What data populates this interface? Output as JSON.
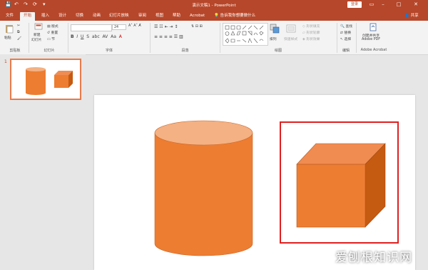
{
  "window": {
    "title": "演示文稿1 - PowerPoint",
    "login_label": "登录",
    "quick_access": [
      "💾",
      "↶",
      "↷",
      "⟳"
    ]
  },
  "tabs": [
    {
      "label": "文件"
    },
    {
      "label": "开始",
      "active": true
    },
    {
      "label": "插入"
    },
    {
      "label": "设计"
    },
    {
      "label": "切换"
    },
    {
      "label": "动画"
    },
    {
      "label": "幻灯片放映"
    },
    {
      "label": "审阅"
    },
    {
      "label": "视图"
    },
    {
      "label": "帮助"
    },
    {
      "label": "Acrobat"
    }
  ],
  "tell_me": "告诉我你想要做什么",
  "share_label": "共享",
  "ribbon": {
    "clipboard": {
      "paste": "粘贴",
      "group": "剪贴板"
    },
    "slides": {
      "new_slide_line1": "新建",
      "new_slide_line2": "幻灯片",
      "layout": "版式",
      "reset": "重置",
      "section": "节",
      "group": "幻灯片"
    },
    "font": {
      "size": "24",
      "group": "字体"
    },
    "paragraph": {
      "group": "段落"
    },
    "drawing": {
      "arrange": "排列",
      "quick_styles": "快速样式",
      "fill": "形状填充",
      "outline": "形状轮廓",
      "effects": "形状效果",
      "group": "绘图"
    },
    "editing": {
      "find": "查找",
      "replace": "替换",
      "select": "选择",
      "group": "编辑"
    },
    "acrobat": {
      "create_line1": "创建并共享",
      "create_line2": "Adobe PDF",
      "group": "Adobe Acrobat"
    }
  },
  "slide_panel": {
    "slide_number": "1"
  },
  "slide": {
    "cylinder_color": "#ed7d31",
    "cylinder_top_color": "#f4b183",
    "cube_front": "#ed7d31",
    "cube_top": "#f08c52",
    "cube_side": "#c55a11",
    "selection_color": "#e02020"
  },
  "watermark": "爱刨根知识网"
}
